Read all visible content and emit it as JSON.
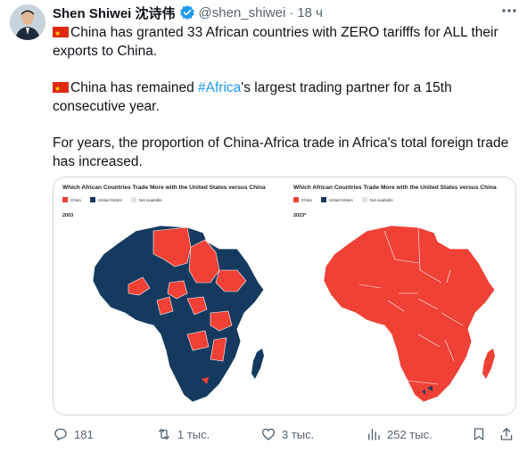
{
  "author": {
    "name": "Shen Shiwei 沈诗伟",
    "handle": "@shen_shiwei",
    "separator": "·",
    "time": "18 ч"
  },
  "tweet": {
    "p1": "China has granted 33 African countries with ZERO tarifffs for ALL their exports to China.",
    "p2_pre": "China has remained ",
    "p2_hashtag": "#Africa",
    "p2_post": "'s largest trading partner for a 15th consecutive year.",
    "p3": "For years, the proportion of China-Africa trade in Africa's total foreign trade has increased."
  },
  "media": {
    "left": {
      "title": "Which African Countries Trade More with the United States versus China",
      "year": "2003",
      "legend": [
        {
          "label": "China",
          "color": "#ef4136"
        },
        {
          "label": "United States",
          "color": "#163a5f"
        },
        {
          "label": "Not available",
          "color": "#e3e3e3"
        }
      ]
    },
    "right": {
      "title": "Which African Countries Trade More with the United States versus China",
      "year": "2023*",
      "legend": [
        {
          "label": "China",
          "color": "#ef4136"
        },
        {
          "label": "United States",
          "color": "#163a5f"
        },
        {
          "label": "Not available",
          "color": "#e3e3e3"
        }
      ]
    }
  },
  "actions": {
    "replies": "181",
    "retweets": "1 тыс.",
    "likes": "3 тыс.",
    "views": "252 тыс."
  },
  "colors": {
    "china": "#ef4136",
    "us": "#163a5f",
    "link": "#1d9bf0",
    "muted": "#536471"
  }
}
